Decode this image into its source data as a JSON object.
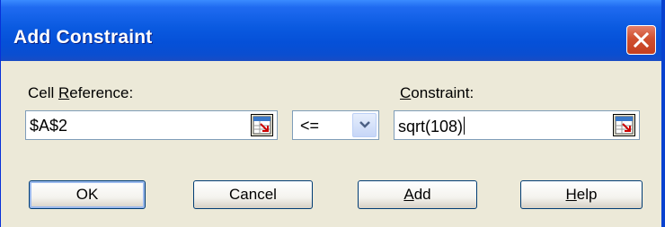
{
  "window": {
    "title": "Add Constraint",
    "close_icon": "close-icon"
  },
  "cell_reference": {
    "label_prefix": "Cell ",
    "label_accel": "R",
    "label_suffix": "eference:",
    "value": "$A$2",
    "ref_icon": "range-select-icon"
  },
  "operator": {
    "selected": "<="
  },
  "constraint": {
    "label_accel": "C",
    "label_suffix": "onstraint:",
    "value": "sqrt(108)",
    "ref_icon": "range-select-icon"
  },
  "buttons": {
    "ok": "OK",
    "cancel": "Cancel",
    "add_accel": "A",
    "add_suffix": "dd",
    "help_accel": "H",
    "help_suffix": "elp"
  },
  "colors": {
    "titlebar": "#0a5ae0",
    "close_button": "#d0502f",
    "dialog_face": "#ece9d8",
    "field_border": "#7f9db9"
  }
}
